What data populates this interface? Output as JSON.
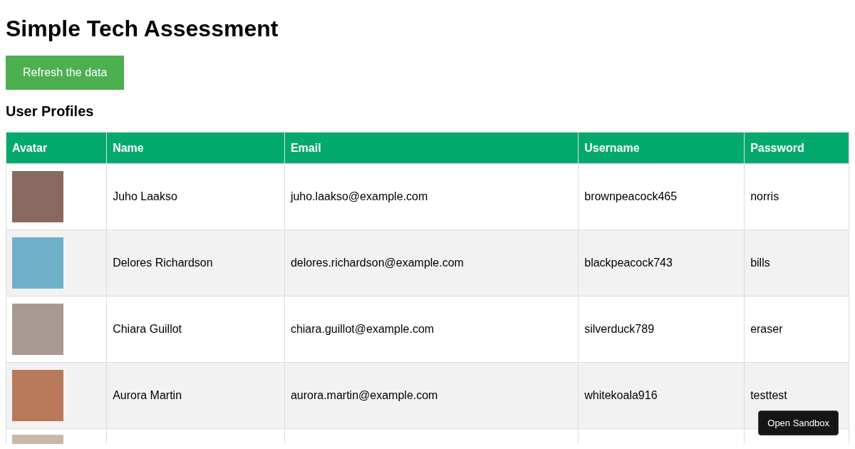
{
  "title": "Simple Tech Assessment",
  "refresh_button": "Refresh the data",
  "section_title": "User Profiles",
  "table": {
    "columns": [
      "Avatar",
      "Name",
      "Email",
      "Username",
      "Password"
    ],
    "rows": [
      {
        "cut_off": false,
        "name": "Juho Laakso",
        "email": "juho.laakso@example.com",
        "username": "brownpeacock465",
        "password": "norris"
      },
      {
        "cut_off": false,
        "name": "Delores Richardson",
        "email": "delores.richardson@example.com",
        "username": "blackpeacock743",
        "password": "bills"
      },
      {
        "cut_off": false,
        "name": "Chiara Guillot",
        "email": "chiara.guillot@example.com",
        "username": "silverduck789",
        "password": "eraser"
      },
      {
        "cut_off": false,
        "name": "Aurora Martin",
        "email": "aurora.martin@example.com",
        "username": "whitekoala916",
        "password": "testtest"
      },
      {
        "cut_off": true
      }
    ]
  },
  "sandbox_button": "Open Sandbox"
}
